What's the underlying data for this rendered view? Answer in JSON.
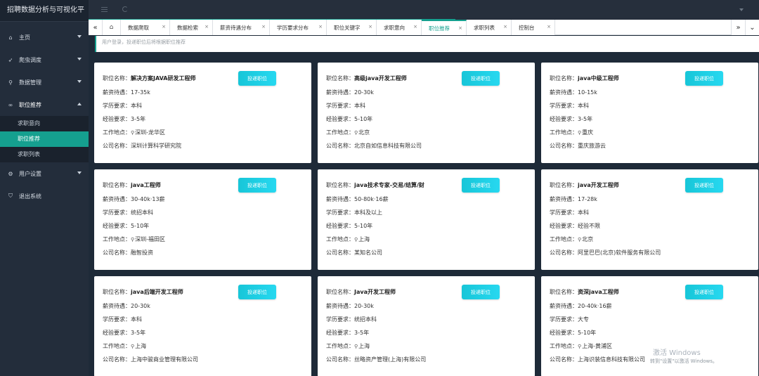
{
  "app": {
    "title": "招聘数据分析与可视化平"
  },
  "sidebar": {
    "items": [
      {
        "label": "主页",
        "icon": "home-icon",
        "has_caret": true
      },
      {
        "label": "爬虫调度",
        "icon": "send-icon",
        "has_caret": true
      },
      {
        "label": "数据管理",
        "icon": "search-icon",
        "has_caret": true
      },
      {
        "label": "职位推荐",
        "icon": "link-icon",
        "open": true
      },
      {
        "label": "用户设置",
        "icon": "gear-icon",
        "has_caret": true
      },
      {
        "label": "退出系统",
        "icon": "shield-icon",
        "has_caret": false
      }
    ],
    "submenu": [
      {
        "label": "求职意向",
        "active": false
      },
      {
        "label": "职位推荐",
        "active": true
      },
      {
        "label": "求职列表",
        "active": false
      }
    ]
  },
  "tabs": {
    "items": [
      {
        "label": "数据爬取",
        "active": false
      },
      {
        "label": "数据检索",
        "active": false
      },
      {
        "label": "薪资待遇分布",
        "active": false
      },
      {
        "label": "学历要求分布",
        "active": false
      },
      {
        "label": "职位关键字",
        "active": false
      },
      {
        "label": "求职意向",
        "active": false
      },
      {
        "label": "职位推荐",
        "active": true
      },
      {
        "label": "求职列表",
        "active": false
      },
      {
        "label": "控制台",
        "active": false
      }
    ],
    "left_arrow": "«",
    "right_arrow": "»",
    "close_glyph": "×"
  },
  "notice": "用户登录，投递职位后将根据职位推荐",
  "labels": {
    "name": "职位名称：",
    "salary": "薪资待遇：",
    "education": "学历要求：",
    "experience": "经验要求：",
    "location": "工作地点：",
    "company": "公司名称：",
    "apply": "投递职位"
  },
  "jobs": [
    {
      "name": "解决方案JAVA研发工程师",
      "salary": "17-35k",
      "education": "本科",
      "experience": "3-5年",
      "location": "深圳-龙华区",
      "company": "深圳计算科学研究院"
    },
    {
      "name": "高级java开发工程师",
      "salary": "20-30k",
      "education": "本科",
      "experience": "5-10年",
      "location": "北京",
      "company": "北京自如信息科技有限公司"
    },
    {
      "name": "java中级工程师",
      "salary": "10-15k",
      "education": "本科",
      "experience": "3-5年",
      "location": "重庆",
      "company": "重庆旅游云"
    },
    {
      "name": "java工程师",
      "salary": "30-40k·13薪",
      "education": "统招本科",
      "experience": "5-10年",
      "location": "深圳-福田区",
      "company": "融智投资"
    },
    {
      "name": "java技术专家-交易/结算/财",
      "salary": "50-80k·16薪",
      "education": "本科及以上",
      "experience": "5-10年",
      "location": "上海",
      "company": "某知名公司"
    },
    {
      "name": "java开发工程师",
      "salary": "17-28k",
      "education": "本科",
      "experience": "经验不限",
      "location": "北京",
      "company": "阿里巴巴(北京)软件服务有限公司"
    },
    {
      "name": "java后端开发工程师",
      "salary": "20-30k",
      "education": "本科",
      "experience": "3-5年",
      "location": "上海",
      "company": "上海中骏商业管理有限公司"
    },
    {
      "name": "Java开发工程师",
      "salary": "20-30k",
      "education": "统招本科",
      "experience": "3-5年",
      "location": "上海",
      "company": "丝略资产管理(上海)有限公司"
    },
    {
      "name": "资深java工程师",
      "salary": "20-40k·16薪",
      "education": "大专",
      "experience": "5-10年",
      "location": "上海-黄浦区",
      "company": "上海识装信息科技有限公司"
    }
  ],
  "watermark": {
    "line1": "激活 Windows",
    "line2": "转到\"设置\"以激活 Windows。"
  },
  "colors": {
    "accent": "#15a08f",
    "button": "#1fcfe6",
    "sidebar": "#232d3b",
    "background": "#1e2a38"
  }
}
